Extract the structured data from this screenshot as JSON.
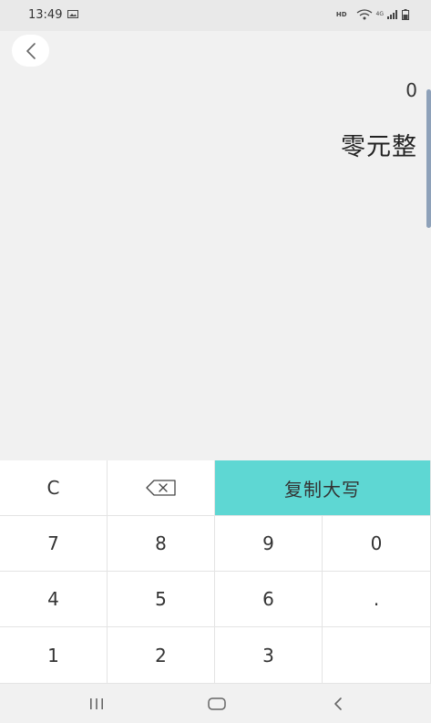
{
  "status": {
    "time": "13:49",
    "hd": "HD",
    "network": "4G"
  },
  "display": {
    "number": "0",
    "chinese": "零元整"
  },
  "keypad": {
    "clear": "C",
    "copy": "复制大写",
    "rows": [
      [
        "7",
        "8",
        "9",
        "0"
      ],
      [
        "4",
        "5",
        "6",
        "."
      ],
      [
        "1",
        "2",
        "3"
      ]
    ]
  },
  "icons": {
    "back": "chevron-left-icon",
    "backspace": "backspace-icon",
    "nav_recent": "recent-apps-icon",
    "nav_home": "home-icon",
    "nav_back": "back-icon"
  },
  "colors": {
    "accent": "#5ed7d3",
    "background": "#f1f1f1",
    "key": "#ffffff"
  }
}
